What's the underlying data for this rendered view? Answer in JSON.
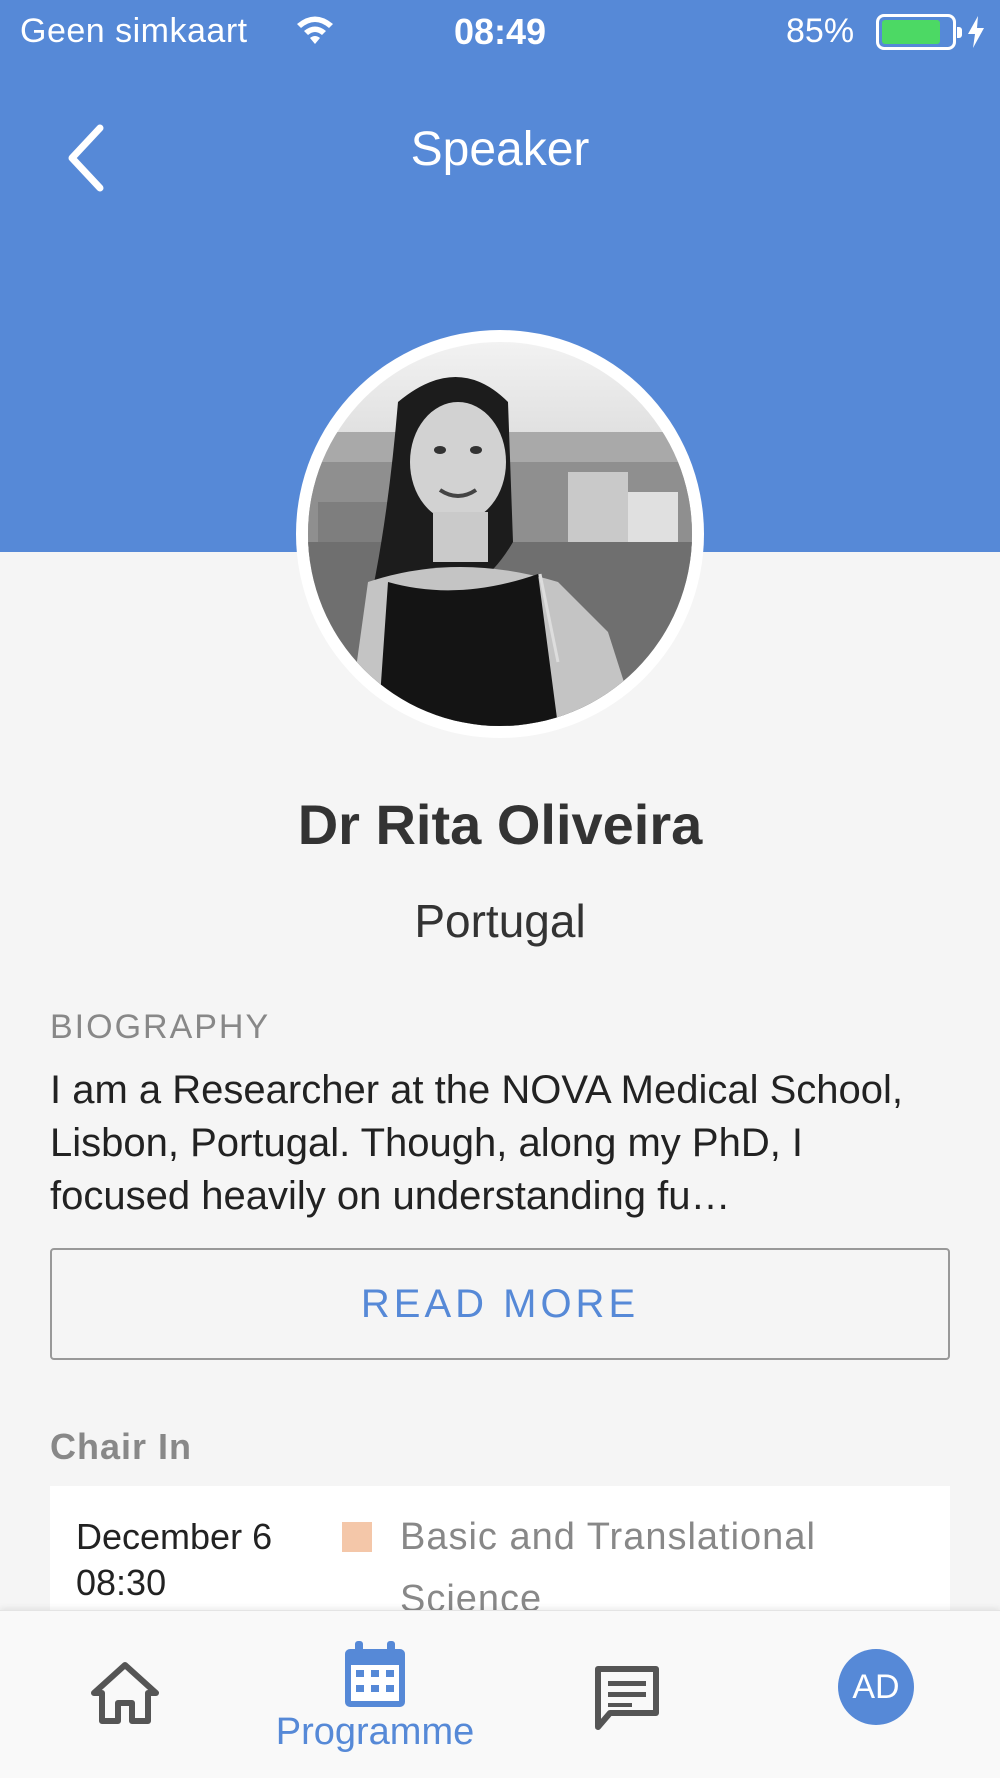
{
  "status_bar": {
    "carrier": "Geen simkaart",
    "time": "08:49",
    "battery": "85%",
    "battery_level": 0.85
  },
  "header": {
    "title": "Speaker"
  },
  "speaker": {
    "name": "Dr Rita Oliveira",
    "country": "Portugal"
  },
  "biography": {
    "label": "BIOGRAPHY",
    "text": "I am a Researcher at the NOVA Medical School, Lisbon, Portugal. Though, along my PhD, I focused heavily on understanding fu…",
    "read_more_label": "READ MORE"
  },
  "chair_in": {
    "label": "Chair In",
    "sessions": [
      {
        "date": "December 6",
        "time": "08:30",
        "track": "Basic and Translational Science",
        "track_color": "#f4c7a9"
      }
    ]
  },
  "tab_bar": {
    "programme_label": "Programme",
    "profile_initials": "AD",
    "accent_color": "#5689d7"
  }
}
